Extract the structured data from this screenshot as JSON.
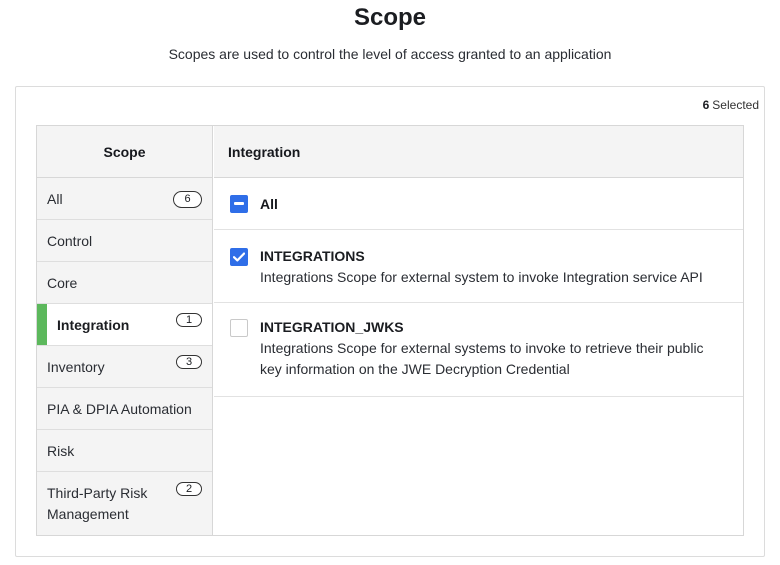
{
  "header": {
    "title": "Scope",
    "subtitle": "Scopes are used to control the level of access granted to an application"
  },
  "selection": {
    "count": "6",
    "label": "Selected"
  },
  "left_panel": {
    "heading": "Scope",
    "categories": [
      {
        "label": "All",
        "badge": "6"
      },
      {
        "label": "Control",
        "badge": ""
      },
      {
        "label": "Core",
        "badge": ""
      },
      {
        "label": "Integration",
        "badge": "1",
        "active": true
      },
      {
        "label": "Inventory",
        "badge": "3"
      },
      {
        "label": "PIA & DPIA Automation",
        "badge": ""
      },
      {
        "label": "Risk",
        "badge": ""
      },
      {
        "label": "Third-Party Risk Management",
        "badge": "2"
      }
    ]
  },
  "right_panel": {
    "heading": "Integration",
    "select_all_label": "All",
    "select_all_state": "indeterminate",
    "scopes": [
      {
        "name": "INTEGRATIONS",
        "description": "Integrations Scope for external system to invoke Integration service API",
        "checked": true
      },
      {
        "name": "INTEGRATION_JWKS",
        "description": "Integrations Scope for external systems to invoke to retrieve their public key information on the JWE Decryption Credential",
        "checked": false
      }
    ]
  },
  "colors": {
    "accent_checkbox": "#2f6ee8",
    "active_marker": "#5cb85c"
  }
}
